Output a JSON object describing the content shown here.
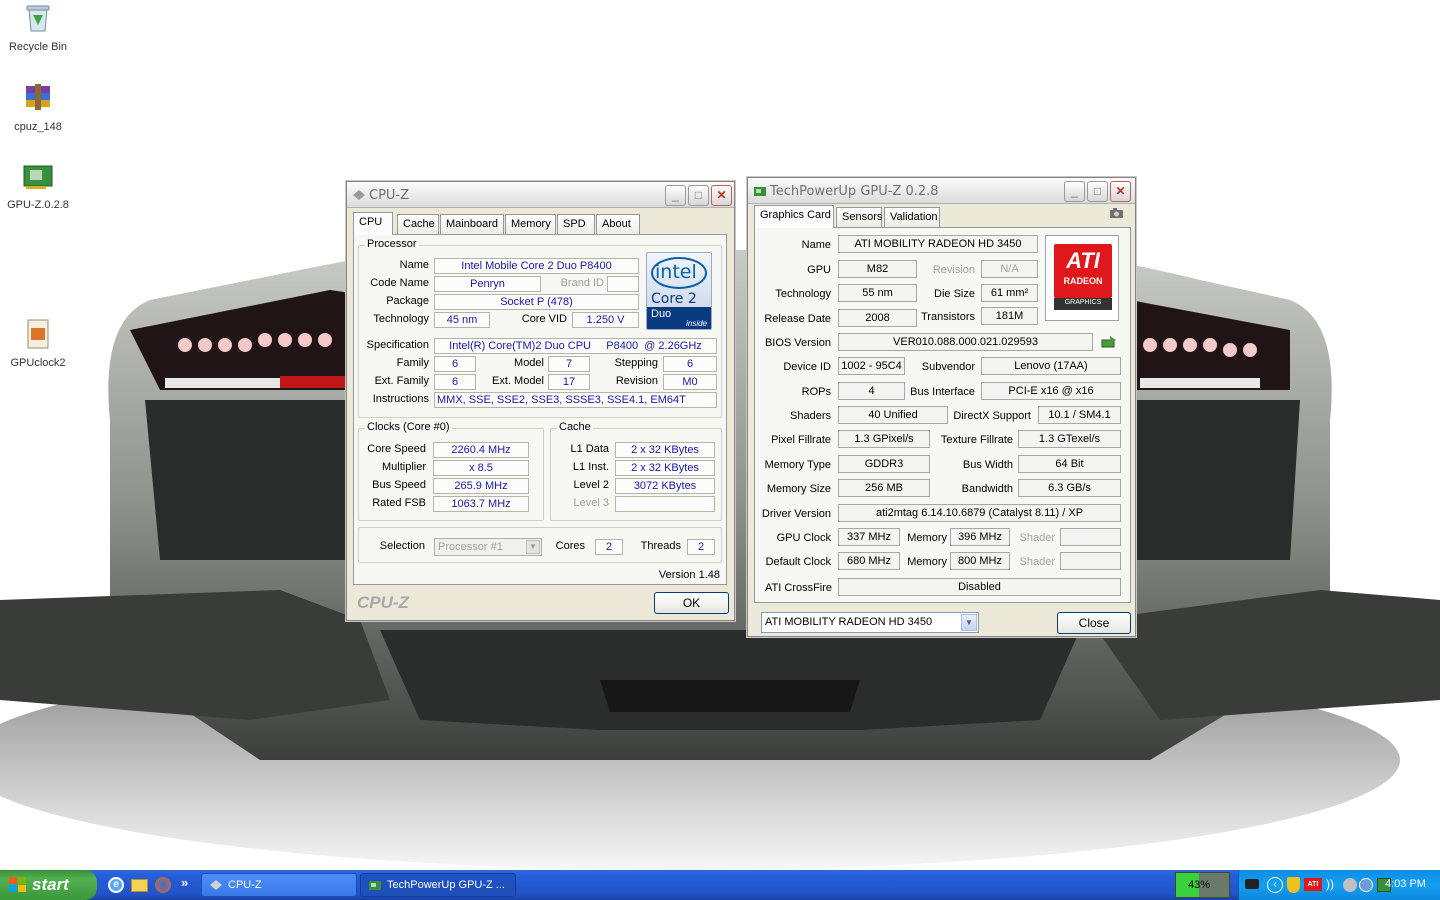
{
  "desktop": {
    "icons": [
      {
        "label": "Recycle Bin",
        "icon": "recycle-bin-icon"
      },
      {
        "label": "cpuz_148",
        "icon": "winrar-archive-icon"
      },
      {
        "label": "GPU-Z.0.2.8",
        "icon": "gpu-card-icon"
      },
      {
        "label": "GPUclock2",
        "icon": "application-icon"
      }
    ]
  },
  "cpuz": {
    "title": "CPU-Z",
    "tabs": [
      "CPU",
      "Cache",
      "Mainboard",
      "Memory",
      "SPD",
      "About"
    ],
    "processor": {
      "group": "Processor",
      "name_label": "Name",
      "name": "Intel Mobile Core 2 Duo P8400",
      "codename_label": "Code Name",
      "codename": "Penryn",
      "brandid_label": "Brand ID",
      "brandid": "",
      "package_label": "Package",
      "package": "Socket P (478)",
      "technology_label": "Technology",
      "technology": "45 nm",
      "corevid_label": "Core VID",
      "corevid": "1.250 V",
      "spec_label": "Specification",
      "spec": "Intel(R) Core(TM)2 Duo CPU     P8400  @ 2.26GHz",
      "family_label": "Family",
      "family": "6",
      "model_label": "Model",
      "model": "7",
      "stepping_label": "Stepping",
      "stepping": "6",
      "extfamily_label": "Ext. Family",
      "extfamily": "6",
      "extmodel_label": "Ext. Model",
      "extmodel": "17",
      "revision_label": "Revision",
      "revision": "M0",
      "instructions_label": "Instructions",
      "instructions": "MMX, SSE, SSE2, SSE3, SSSE3, SSE4.1, EM64T",
      "logo_brand": "intel",
      "logo_product": "Core 2",
      "logo_sub": "Duo",
      "logo_inside": "inside"
    },
    "clocks": {
      "group": "Clocks (Core #0)",
      "corespeed_label": "Core Speed",
      "corespeed": "2260.4 MHz",
      "multiplier_label": "Multiplier",
      "multiplier": "x 8.5",
      "busspeed_label": "Bus Speed",
      "busspeed": "265.9 MHz",
      "ratedfsb_label": "Rated FSB",
      "ratedfsb": "1063.7 MHz"
    },
    "cache": {
      "group": "Cache",
      "l1data_label": "L1 Data",
      "l1data": "2 x 32 KBytes",
      "l1inst_label": "L1 Inst.",
      "l1inst": "2 x 32 KBytes",
      "level2_label": "Level 2",
      "level2": "3072 KBytes",
      "level3_label": "Level 3",
      "level3": ""
    },
    "selection_label": "Selection",
    "selection_value": "Processor #1",
    "cores_label": "Cores",
    "cores": "2",
    "threads_label": "Threads",
    "threads": "2",
    "version": "Version 1.48",
    "brand_footer": "CPU-Z",
    "ok_label": "OK"
  },
  "gpuz": {
    "title": "TechPowerUp GPU-Z 0.2.8",
    "tabs": [
      "Graphics Card",
      "Sensors",
      "Validation"
    ],
    "name_label": "Name",
    "name": "ATI MOBILITY RADEON HD 3450",
    "gpu_label": "GPU",
    "gpu": "M82",
    "revision_label": "Revision",
    "revision": "N/A",
    "technology_label": "Technology",
    "technology": "55 nm",
    "diesize_label": "Die Size",
    "diesize": "61 mm²",
    "releasedate_label": "Release Date",
    "releasedate": "2008",
    "transistors_label": "Transistors",
    "transistors": "181M",
    "bios_label": "BIOS Version",
    "bios": "VER010.088.000.021.029593",
    "deviceid_label": "Device ID",
    "deviceid": "1002 - 95C4",
    "subvendor_label": "Subvendor",
    "subvendor": "Lenovo (17AA)",
    "rops_label": "ROPs",
    "rops": "4",
    "businterface_label": "Bus Interface",
    "businterface": "PCI-E x16 @ x16",
    "shaders_label": "Shaders",
    "shaders": "40 Unified",
    "directx_label": "DirectX Support",
    "directx": "10.1 / SM4.1",
    "pixelfill_label": "Pixel Fillrate",
    "pixelfill": "1.3 GPixel/s",
    "texturefill_label": "Texture Fillrate",
    "texturefill": "1.3 GTexel/s",
    "memtype_label": "Memory Type",
    "memtype": "GDDR3",
    "buswidth_label": "Bus Width",
    "buswidth": "64 Bit",
    "memsize_label": "Memory Size",
    "memsize": "256 MB",
    "bandwidth_label": "Bandwidth",
    "bandwidth": "6.3 GB/s",
    "driver_label": "Driver Version",
    "driver": "ati2mtag 6.14.10.6879 (Catalyst 8.11) / XP",
    "gpuclock_label": "GPU Clock",
    "gpuclock": "337 MHz",
    "memory_label": "Memory",
    "gpumemclock": "396 MHz",
    "shader_label": "Shader",
    "gpushader": "",
    "defclock_label": "Default Clock",
    "defclock": "680 MHz",
    "defmemclock": "800 MHz",
    "defshader": "",
    "crossfire_label": "ATI CrossFire",
    "crossfire": "Disabled",
    "device_select": "ATI MOBILITY RADEON HD 3450",
    "close_label": "Close",
    "logo_brand": "ATI",
    "logo_product": "RADEON",
    "logo_sub": "GRAPHICS"
  },
  "taskbar": {
    "start_label": "start",
    "buttons": [
      "CPU-Z",
      "TechPowerUp GPU-Z ..."
    ],
    "more_glyph": "»",
    "battery": "43%",
    "battery_level": 0.43,
    "clock": "4:03 PM"
  }
}
